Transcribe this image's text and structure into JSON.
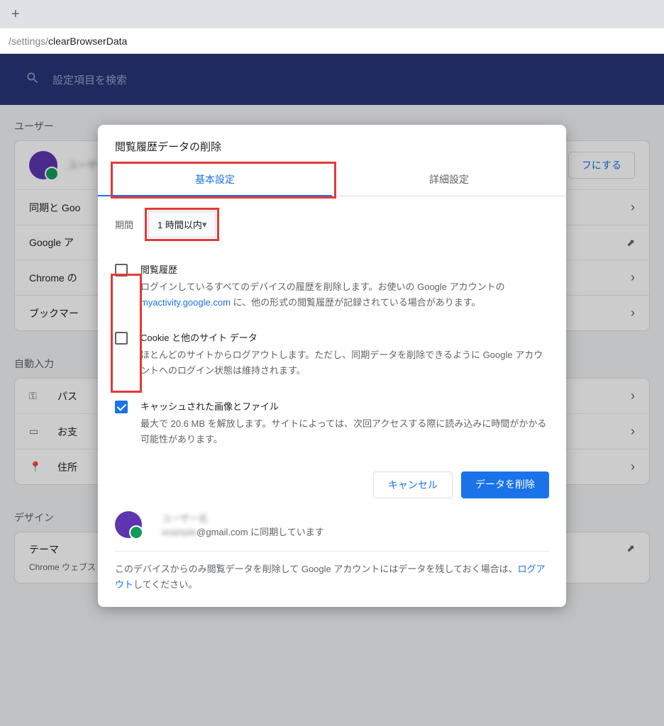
{
  "url": {
    "prefix": "/settings/",
    "page": "clearBrowserData"
  },
  "search": {
    "placeholder": "設定項目を検索"
  },
  "bg": {
    "section_user": "ユーザー",
    "user_name": "ユーザー",
    "off_button": "フにする",
    "sync": "同期と Goo",
    "google_a": "Google ア",
    "chrome_n": "Chrome の",
    "bookmark": "ブックマー",
    "section_autofill": "自動入力",
    "password": "パス",
    "payment": "お支",
    "address": "住所",
    "section_design": "デザイン",
    "theme": "テーマ",
    "theme_sub": "Chrome ウェブストアを開きます"
  },
  "dialog": {
    "title": "閲覧履歴データの削除",
    "tab_basic": "基本設定",
    "tab_advanced": "詳細設定",
    "period_label": "期間",
    "period_value": "1 時間以内",
    "opt1_title": "閲覧履歴",
    "opt1_desc_a": "ログインしているすべてのデバイスの履歴を削除します。お使いの Google アカウントの ",
    "opt1_link": "myactivity.google.com",
    "opt1_desc_b": " に、他の形式の閲覧履歴が記録されている場合があります。",
    "opt2_title": "Cookie と他のサイト データ",
    "opt2_desc": "ほとんどのサイトからログアウトします。ただし、同期データを削除できるように Google アカウントへのログイン状態は維持されます。",
    "opt3_title": "キャッシュされた画像とファイル",
    "opt3_desc": "最大で 20.6 MB を解放します。サイトによっては、次回アクセスする際に読み込みに時間がかかる可能性があります。",
    "cancel": "キャンセル",
    "clear": "データを削除",
    "sync_line": "@gmail.com に同期しています",
    "footer_a": "このデバイスからのみ閲覧データを削除して Google アカウントにはデータを残しておく場合は、",
    "footer_link": "ログアウト",
    "footer_b": "してください。"
  }
}
